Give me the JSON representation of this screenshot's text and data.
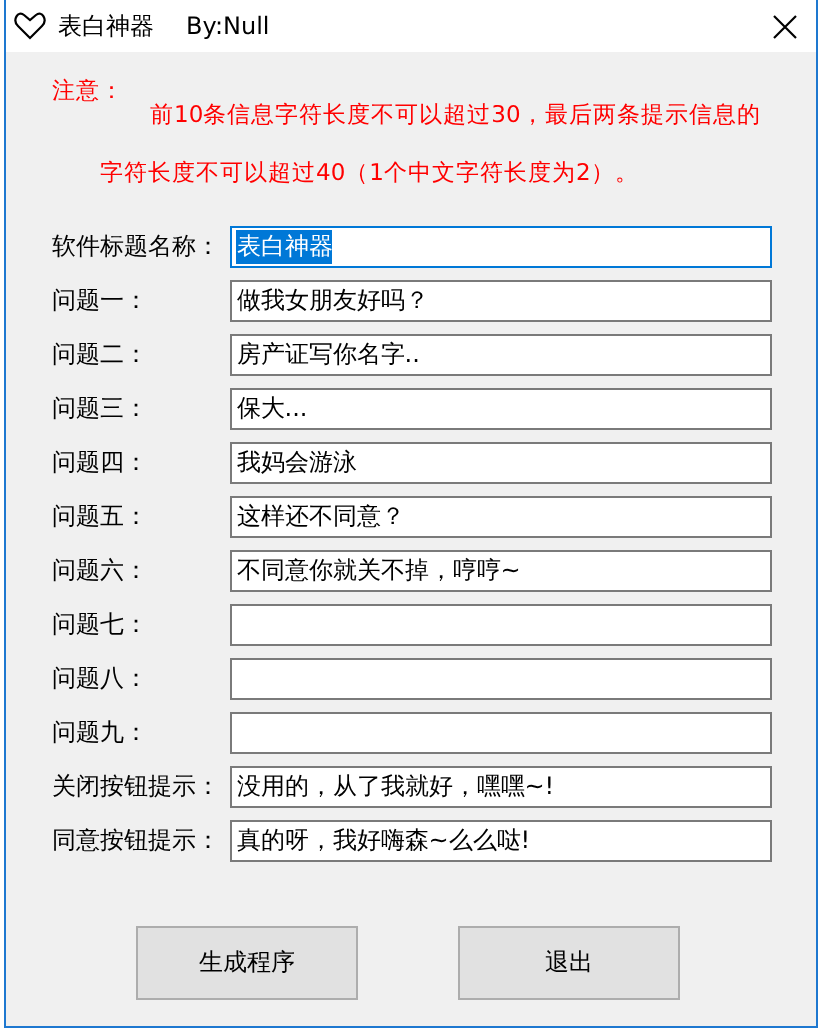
{
  "window": {
    "title": "表白神器",
    "subtitle": "By:Null"
  },
  "notice": {
    "heading": "注意：",
    "lines": [
      "前10条信息字符长度不可以超过30，最后两条提示信息的",
      "字符长度不可以超过40（1个中文字符长度为2）。"
    ]
  },
  "fields": [
    {
      "label": "软件标题名称：",
      "value": "表白神器",
      "focused": true
    },
    {
      "label": "问题一：",
      "value": "做我女朋友好吗？",
      "focused": false
    },
    {
      "label": "问题二：",
      "value": "房产证写你名字..",
      "focused": false
    },
    {
      "label": "问题三：",
      "value": "保大...",
      "focused": false
    },
    {
      "label": "问题四：",
      "value": "我妈会游泳",
      "focused": false
    },
    {
      "label": "问题五：",
      "value": "这样还不同意？",
      "focused": false
    },
    {
      "label": "问题六：",
      "value": "不同意你就关不掉，哼哼~",
      "focused": false
    },
    {
      "label": "问题七：",
      "focused": false
    },
    {
      "label": "问题八：",
      "focused": false
    },
    {
      "label": "问题九：",
      "focused": false
    },
    {
      "label": "关闭按钮提示：",
      "value": "没用的，从了我就好，嘿嘿~!",
      "focused": false
    },
    {
      "label": "同意按钮提示：",
      "value": "真的呀，我好嗨森~么么哒!",
      "focused": false
    }
  ],
  "buttons": [
    "生成程序",
    "退出"
  ]
}
